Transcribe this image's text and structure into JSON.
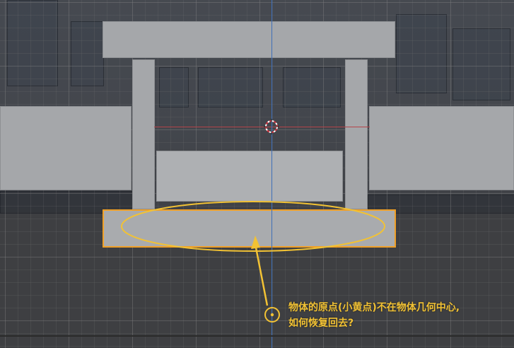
{
  "annotation": {
    "line1": "物体的原点(小黄点)不在物体几何中心,",
    "line2": "如何恢复回去?"
  },
  "colors": {
    "annotation_yellow": "#f2c234",
    "selection_orange": "#f0a027",
    "axis_x_red": "#b54349",
    "axis_z_blue": "#3f6fb8",
    "mesh_gray": "#a5a7aa",
    "viewport_bg": "#3e3f42"
  },
  "icons": {
    "cursor": "3d-cursor-icon",
    "origin": "object-origin-icon"
  }
}
